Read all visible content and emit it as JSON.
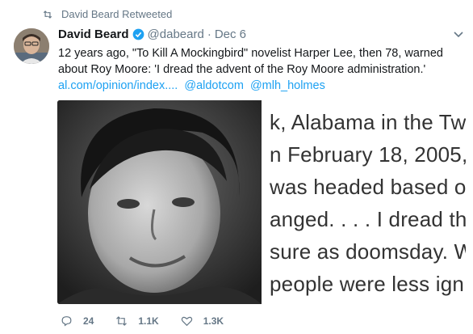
{
  "retweet_header": {
    "text": "David Beard Retweeted",
    "icon": "retweet-icon"
  },
  "tweet": {
    "author_name": "David Beard",
    "verified": true,
    "handle": "@dabeard",
    "separator": "·",
    "timestamp": "Dec 6",
    "text_lines": [
      "12 years ago, \"To Kill A Mockingbird\" novelist Harper Lee, then 78, warned",
      "about Roy Moore: 'I dread the advent of the Roy Moore administration.'"
    ],
    "links": [
      "al.com/opinion/index....",
      "@aldotcom",
      "@mlh_holmes"
    ],
    "media": {
      "article_lines": [
        "k, Alabama in the Tw",
        "n February 18, 2005,",
        " was headed  based o",
        "anged. . . .  I dread the",
        "sure as doomsday. W",
        " people were less ign"
      ]
    },
    "actions": {
      "reply_count": "24",
      "retweet_count": "1.1K",
      "like_count": "1.3K"
    }
  },
  "colors": {
    "link": "#1da1f2",
    "muted": "#657786",
    "text": "#14171a"
  }
}
